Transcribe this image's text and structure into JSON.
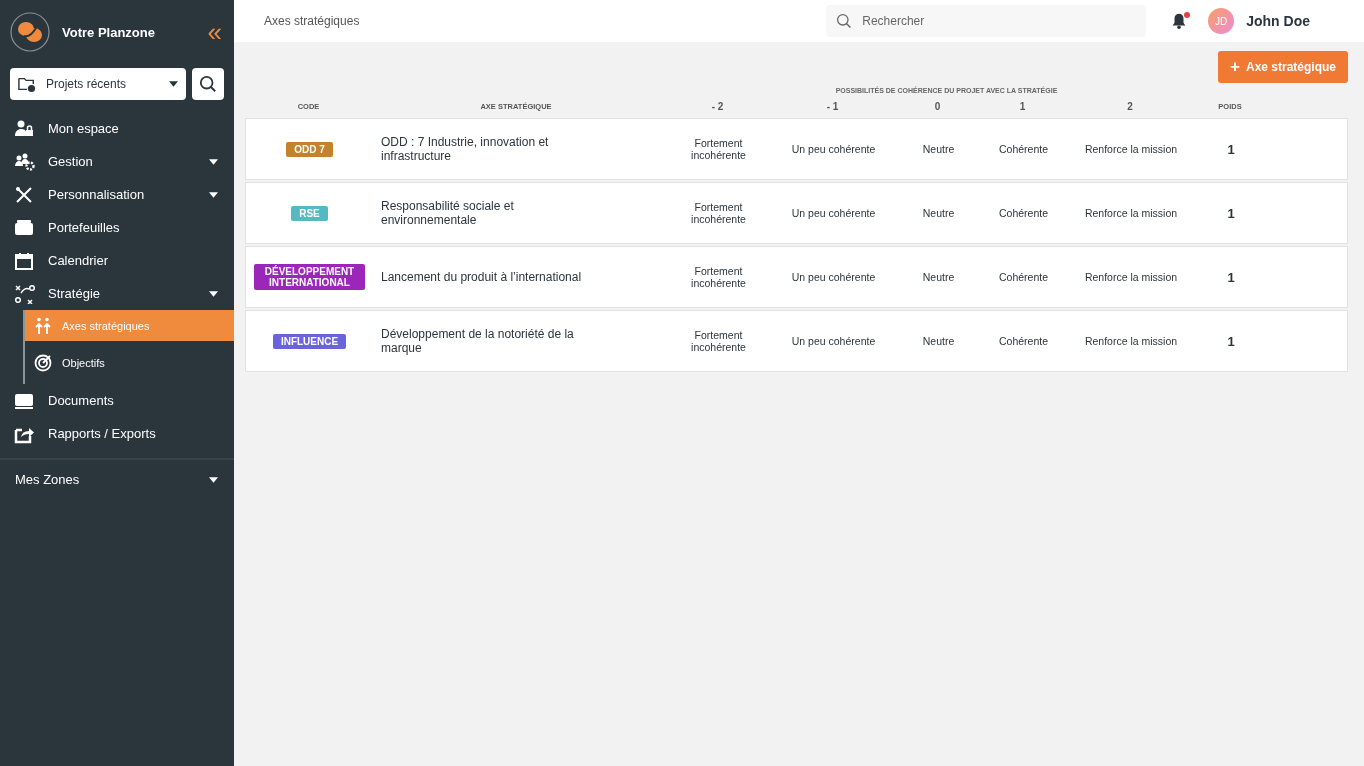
{
  "sidebar": {
    "brand": "Votre Planzone",
    "collapse": "«",
    "recent": {
      "label": "Projets récents"
    },
    "items": [
      {
        "label": "Mon espace",
        "expandable": false
      },
      {
        "label": "Gestion",
        "expandable": true
      },
      {
        "label": "Personnalisation",
        "expandable": true
      },
      {
        "label": "Portefeuilles",
        "expandable": false
      },
      {
        "label": "Calendrier",
        "expandable": false
      },
      {
        "label": "Stratégie",
        "expandable": true,
        "children": [
          {
            "label": "Axes stratégiques",
            "selected": true
          },
          {
            "label": "Objectifs",
            "selected": false
          }
        ]
      },
      {
        "label": "Documents",
        "expandable": false
      },
      {
        "label": "Rapports / Exports",
        "expandable": false
      }
    ],
    "zones": {
      "label": "Mes Zones",
      "expandable": true
    }
  },
  "topbar": {
    "title": "Axes stratégiques",
    "search": {
      "placeholder": "Rechercher"
    },
    "notification": true,
    "user": {
      "initials": "JD",
      "name": "John Doe"
    }
  },
  "add_button": {
    "icon": "+",
    "label": "Axe stratégique"
  },
  "table": {
    "group_header": "POSSIBILITÉS DE COHÉRENCE DU PROJET AVEC LA STRATÉGIE",
    "columns": [
      "CODE",
      "AXE STRATÉGIQUE",
      "- 2",
      "- 1",
      "0",
      "1",
      "2",
      "POIDS"
    ],
    "rows": [
      {
        "code": {
          "label": "ODD 7",
          "color": "#c2832c"
        },
        "axis": "ODD : 7 Industrie, innovation et infrastructure",
        "levels": [
          "Fortement incohérente",
          "Un peu cohérente",
          "Neutre",
          "Cohérente",
          "Renforce la mission"
        ],
        "weight": "1"
      },
      {
        "code": {
          "label": "RSE",
          "color": "#55b9c4"
        },
        "axis": "Responsabilité sociale et environnementale",
        "levels": [
          "Fortement incohérente",
          "Un peu cohérente",
          "Neutre",
          "Cohérente",
          "Renforce la mission"
        ],
        "weight": "1"
      },
      {
        "code": {
          "label": "DÉVELOPPEMENT INTERNATIONAL",
          "color": "#9b27b9"
        },
        "axis": "Lancement du produit à l’international",
        "levels": [
          "Fortement incohérente",
          "Un peu cohérente",
          "Neutre",
          "Cohérente",
          "Renforce la mission"
        ],
        "weight": "1"
      },
      {
        "code": {
          "label": "INFLUENCE",
          "color": "#6a63dc"
        },
        "axis": "Développement de la notoriété de la marque",
        "levels": [
          "Fortement incohérente",
          "Un peu cohérente",
          "Neutre",
          "Cohérente",
          "Renforce la mission"
        ],
        "weight": "1"
      }
    ]
  }
}
